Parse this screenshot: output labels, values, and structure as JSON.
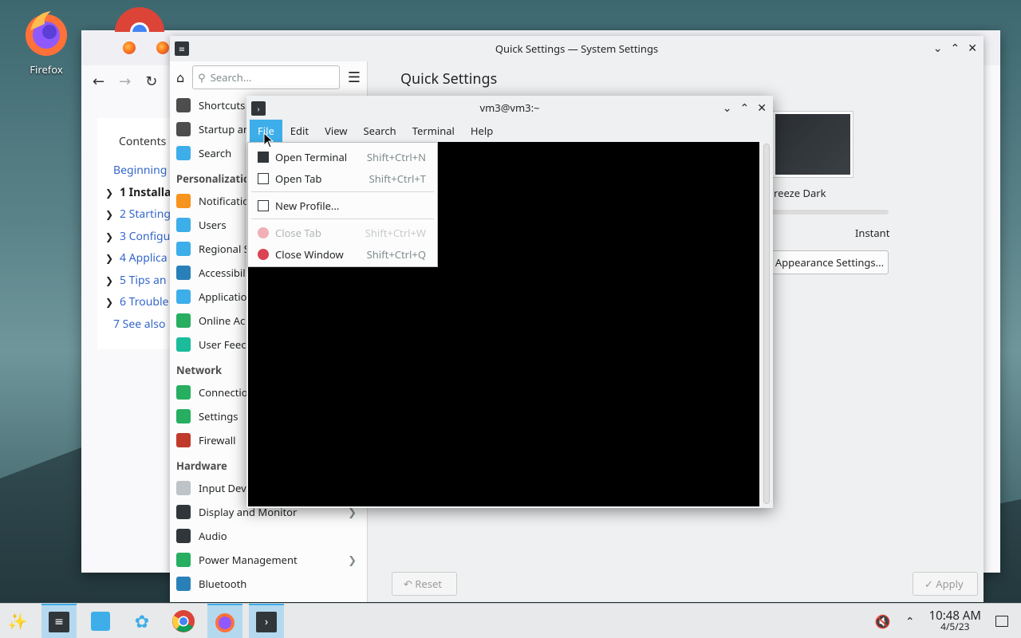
{
  "desktop": {
    "firefox_label": "Firefox"
  },
  "firefox": {
    "contents_title": "Contents",
    "toc": [
      {
        "label": "Beginning",
        "expand": false
      },
      {
        "label": "1  Installa",
        "expand": true,
        "bold": true
      },
      {
        "label": "2  Starting",
        "expand": true
      },
      {
        "label": "3  Configu",
        "expand": true
      },
      {
        "label": "4  Applica",
        "expand": true
      },
      {
        "label": "5  Tips an",
        "expand": true
      },
      {
        "label": "6  Trouble",
        "expand": true
      },
      {
        "label": "7  See also",
        "expand": false
      }
    ]
  },
  "system_settings": {
    "title": "Quick Settings — System Settings",
    "search_placeholder": "Search...",
    "main_title": "Quick Settings",
    "theme_name": "reeze Dark",
    "animation_label": "Instant",
    "appearance_button": "Appearance Settings...",
    "reset_button": "Reset",
    "apply_button": "Apply",
    "sidebar": [
      {
        "type": "item",
        "label": "Shortcuts",
        "color": "#4d4d4d"
      },
      {
        "type": "item",
        "label": "Startup ar",
        "color": "#4d4d4d"
      },
      {
        "type": "item",
        "label": "Search",
        "color": "#3daee9"
      },
      {
        "type": "head",
        "label": "Personalizatio"
      },
      {
        "type": "item",
        "label": "Notificatio",
        "color": "#f7941d"
      },
      {
        "type": "item",
        "label": "Users",
        "color": "#3daee9"
      },
      {
        "type": "item",
        "label": "Regional S",
        "color": "#3daee9"
      },
      {
        "type": "item",
        "label": "Accessibil",
        "color": "#2980b9"
      },
      {
        "type": "item",
        "label": "Applicatio",
        "color": "#3daee9"
      },
      {
        "type": "item",
        "label": "Online Ac",
        "color": "#27ae60"
      },
      {
        "type": "item",
        "label": "User Feec",
        "color": "#1abc9c"
      },
      {
        "type": "head",
        "label": "Network"
      },
      {
        "type": "item",
        "label": "Connectio",
        "color": "#27ae60"
      },
      {
        "type": "item",
        "label": "Settings",
        "color": "#27ae60"
      },
      {
        "type": "item",
        "label": "Firewall",
        "color": "#c0392b"
      },
      {
        "type": "head",
        "label": "Hardware"
      },
      {
        "type": "item",
        "label": "Input Dev",
        "color": "#bdc3c7"
      },
      {
        "type": "item",
        "label": "Display and Monitor",
        "color": "#31363b",
        "chevron": true
      },
      {
        "type": "item",
        "label": "Audio",
        "color": "#31363b"
      },
      {
        "type": "item",
        "label": "Power Management",
        "color": "#27ae60",
        "chevron": true
      },
      {
        "type": "item",
        "label": "Bluetooth",
        "color": "#2980b9"
      }
    ]
  },
  "terminal": {
    "title": "vm3@vm3:~",
    "menu": [
      "File",
      "Edit",
      "View",
      "Search",
      "Terminal",
      "Help"
    ],
    "active_menu": 0
  },
  "file_menu": {
    "items": [
      {
        "label": "Open Terminal",
        "shortcut": "Shift+Ctrl+N",
        "icon": "terminal-icon",
        "disabled": false
      },
      {
        "label": "Open Tab",
        "shortcut": "Shift+Ctrl+T",
        "icon": "new-tab-icon",
        "disabled": false
      },
      {
        "sep": true
      },
      {
        "label": "New Profile...",
        "shortcut": "",
        "icon": "document-icon",
        "disabled": false
      },
      {
        "sep": true
      },
      {
        "label": "Close Tab",
        "shortcut": "Shift+Ctrl+W",
        "icon": "close-circle-icon",
        "disabled": true
      },
      {
        "label": "Close Window",
        "shortcut": "Shift+Ctrl+Q",
        "icon": "close-circle-icon",
        "disabled": false
      }
    ]
  },
  "taskbar": {
    "time": "10:48 AM",
    "date": "4/5/23"
  }
}
